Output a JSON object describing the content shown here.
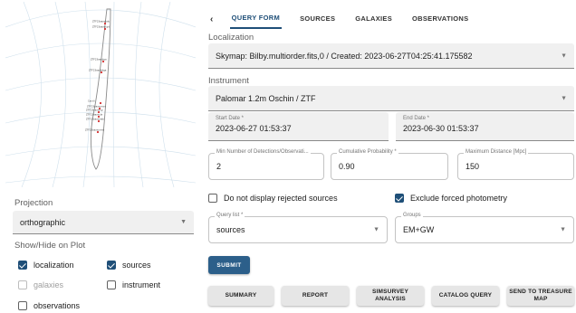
{
  "skymap": {
    "labels": [
      "ZTF23aaxxkdu",
      "ZTF23aaxxcyd",
      "ZTF23aaxbya",
      "ZTF23aaxbdga",
      "Candi",
      "ZTF23aaxxxnon",
      "ZTF23aaxxrcp",
      "ZTF23aaxxcla",
      "ZTF23aaxxolab",
      "ZTF23aaxxnrmo"
    ],
    "marker_color": "#d32f2f"
  },
  "left": {
    "projection_label": "Projection",
    "projection_value": "orthographic",
    "show_hide_label": "Show/Hide on Plot",
    "checks": {
      "localization": {
        "label": "localization",
        "checked": true
      },
      "sources": {
        "label": "sources",
        "checked": true
      },
      "galaxies": {
        "label": "galaxies",
        "checked": false,
        "disabled": true
      },
      "instrument": {
        "label": "instrument",
        "checked": false
      },
      "observations": {
        "label": "observations",
        "checked": false
      }
    }
  },
  "tabs": {
    "back_icon": "chevron-left",
    "items": [
      "QUERY FORM",
      "SOURCES",
      "GALAXIES",
      "OBSERVATIONS"
    ],
    "active": "QUERY FORM"
  },
  "form": {
    "localization_label": "Localization",
    "localization_value": "Skymap: Bilby.multiorder.fits,0 / Created: 2023-06-27T04:25:41.175582",
    "instrument_label": "Instrument",
    "instrument_value": "Palomar 1.2m Oschin / ZTF",
    "start_date_label": "Start Date *",
    "start_date_value": "2023-06-27 01:53:37",
    "end_date_label": "End Date *",
    "end_date_value": "2023-06-30 01:53:37",
    "min_detections_label": "Min Number of Detections/Observati...",
    "min_detections_value": "2",
    "cumulative_prob_label": "Cumulative Probability *",
    "cumulative_prob_value": "0.90",
    "max_distance_label": "Maximum Distance [Mpc]",
    "max_distance_value": "150",
    "reject_label": "Do not display rejected sources",
    "reject_checked": false,
    "forced_label": "Exclude forced photometry",
    "forced_checked": true,
    "query_list_label": "Query list *",
    "query_list_value": "sources",
    "groups_label": "Groups",
    "groups_value": "EM+GW",
    "submit_label": "SUBMIT"
  },
  "actions": {
    "summary": "SUMMARY",
    "report": "REPORT",
    "simsurvey": "SIMSURVEY ANALYSIS",
    "catalog_query": "CATALOG QUERY",
    "treasure_map": "SEND TO TREASURE MAP"
  },
  "colors": {
    "primary": "#1f4f78",
    "button_primary": "#2c5f8a",
    "field_bg": "#f0f0f0"
  }
}
